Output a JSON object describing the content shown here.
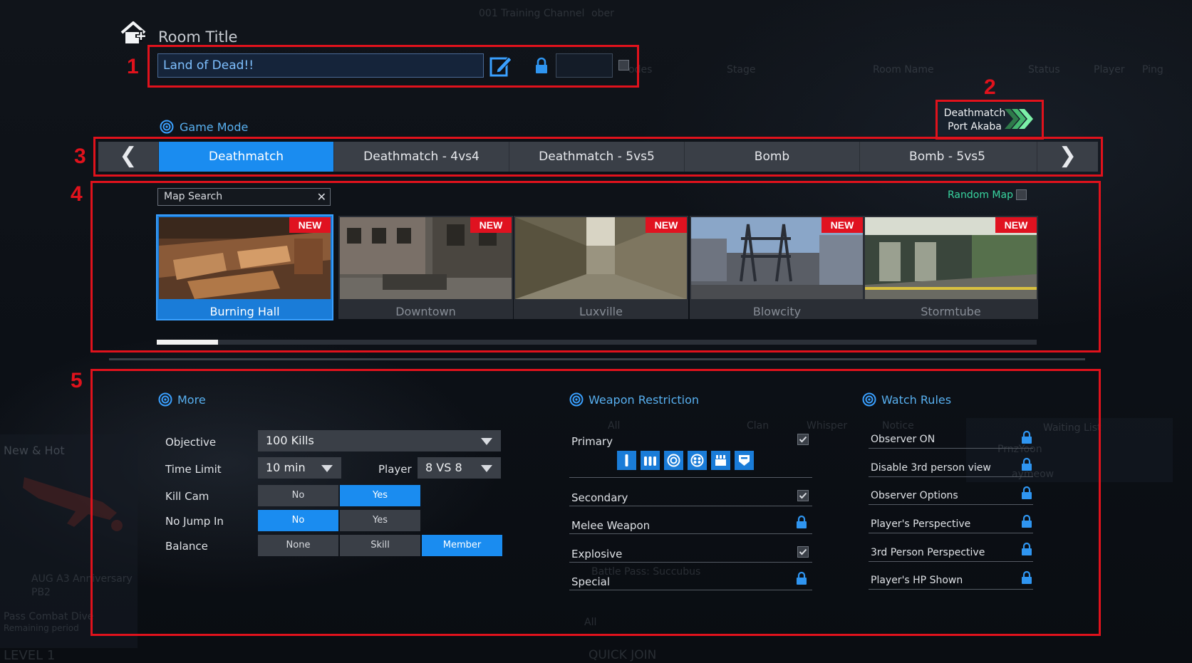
{
  "background": {
    "channel_text": "001 Training Channel",
    "channel_suffix": "ober",
    "columns": [
      "odes",
      "Stage",
      "Room Name",
      "Status",
      "Player",
      "Ping"
    ],
    "new_hot": "New & Hot",
    "item_name": "AUG A3 Anniversary",
    "item_sub": "PB2",
    "pass_text": "Pass Combat Dive",
    "pass_sub": "Remaining period",
    "level": "LEVEL 1",
    "waiting_list": "Waiting List",
    "player1": "PrnzYoon",
    "player2": "aymeow",
    "chat_tabs": [
      "All",
      "Clan",
      "Whisper",
      "Notice"
    ],
    "battlepass": "Battle Pass: Succubus",
    "quick_join": "QUICK JOIN",
    "all_filter": "All"
  },
  "header": {
    "room_title_label": "Room Title",
    "room_title_value": "Land of Dead!!"
  },
  "annotations": [
    "1",
    "2",
    "3",
    "4",
    "5"
  ],
  "recommended": {
    "line1": "Deathmatch",
    "line2": "Port Akaba"
  },
  "game_mode": {
    "label": "Game Mode",
    "prev_arrow": "❮",
    "next_arrow": "❯",
    "tabs": [
      "Deathmatch",
      "Deathmatch - 4vs4",
      "Deathmatch - 5vs5",
      "Bomb",
      "Bomb - 5vs5"
    ],
    "selected": 0
  },
  "maps": {
    "search_placeholder": "Map Search",
    "search_clear": "✕",
    "random_map_label": "Random Map",
    "badge": "NEW",
    "items": [
      {
        "name": "Burning Hall"
      },
      {
        "name": "Downtown"
      },
      {
        "name": "Luxville"
      },
      {
        "name": "Blowcity"
      },
      {
        "name": "Stormtube"
      }
    ],
    "scroll_fraction": 0.07
  },
  "more": {
    "label": "More",
    "objective_label": "Objective",
    "objective_value": "100 Kills",
    "time_limit_label": "Time Limit",
    "time_limit_value": "10 min",
    "player_label": "Player",
    "player_value": "8 VS 8",
    "kill_cam_label": "Kill Cam",
    "kill_cam_options": [
      "No",
      "Yes"
    ],
    "no_jump_label": "No Jump In",
    "no_jump_options": [
      "No",
      "Yes"
    ],
    "balance_label": "Balance",
    "balance_options": [
      "None",
      "Skill",
      "Member"
    ]
  },
  "weapon_restriction": {
    "label": "Weapon Restriction",
    "rows": [
      "Primary",
      "Secondary",
      "Melee Weapon",
      "Explosive",
      "Special"
    ],
    "primary_icons": [
      "assault-rifle-icon",
      "smg-icon",
      "sniper-icon",
      "shotgun-icon",
      "machine-gun-icon",
      "shield-icon"
    ]
  },
  "watch_rules": {
    "label": "Watch Rules",
    "rows": [
      "Observer ON",
      "Disable 3rd person view",
      "Observer Options",
      "Player's Perspective",
      "3rd Person Perspective",
      "Player's HP Shown"
    ]
  },
  "colors": {
    "accent": "#1a8cf0",
    "annotation": "#e0121c",
    "label_blue": "#58b0f0",
    "random_green": "#38d6a0",
    "new_badge": "#e01220"
  }
}
